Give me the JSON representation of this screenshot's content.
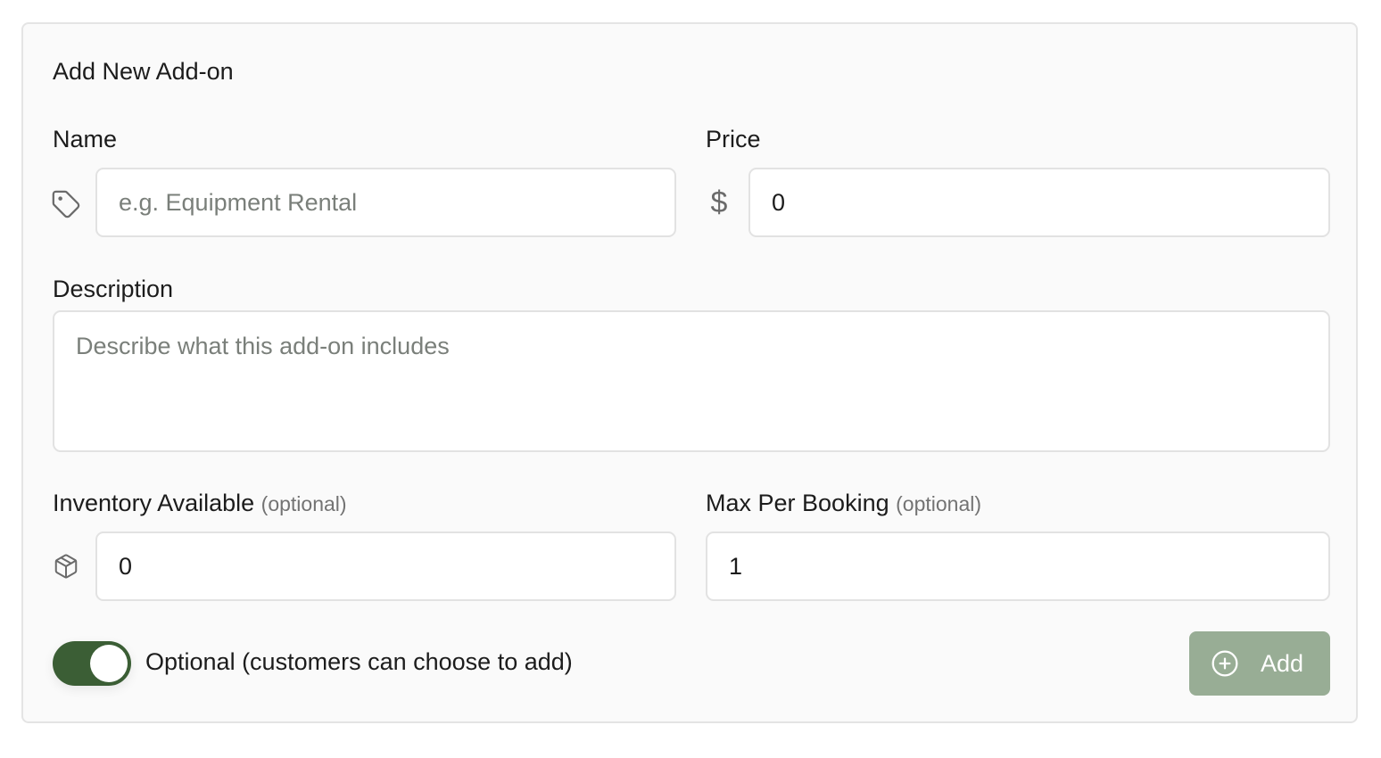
{
  "form": {
    "title": "Add New Add-on",
    "name": {
      "label": "Name",
      "placeholder": "e.g. Equipment Rental",
      "value": "",
      "icon": "tag-icon"
    },
    "price": {
      "label": "Price",
      "value": "0",
      "prefix": "$"
    },
    "description": {
      "label": "Description",
      "placeholder": "Describe what this add-on includes",
      "value": ""
    },
    "inventory": {
      "label": "Inventory Available",
      "optional_note": "(optional)",
      "value": "0",
      "icon": "box-icon"
    },
    "max_per_booking": {
      "label": "Max Per Booking",
      "optional_note": "(optional)",
      "value": "1"
    },
    "optional_toggle": {
      "label": "Optional (customers can choose to add)",
      "on": true,
      "color": "#3b5e35"
    },
    "add_button": {
      "label": "Add",
      "icon": "plus-circle-icon",
      "color": "#98ad95"
    }
  }
}
